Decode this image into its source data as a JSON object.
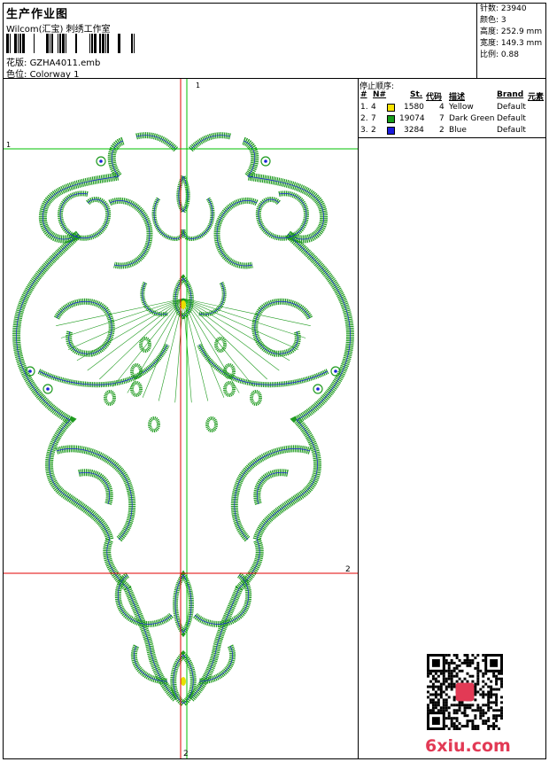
{
  "header": {
    "title": "生产作业图",
    "company": "Wilcom(汇宝) 刺绣工作室",
    "design_label": "花版:",
    "design_value": "GZHA4011.emb",
    "colorway_label": "色位:",
    "colorway_value": "Colorway 1"
  },
  "stats": [
    {
      "label": "针数:",
      "value": "23940"
    },
    {
      "label": "颜色:",
      "value": "3"
    },
    {
      "label": "高度:",
      "value": "252.9 mm"
    },
    {
      "label": "宽度:",
      "value": "149.3 mm"
    },
    {
      "label": "比例:",
      "value": "0.88"
    }
  ],
  "legend": {
    "title": "停止顺序:",
    "headers": [
      "#",
      "N#",
      "St.",
      "代码",
      "描述",
      "Brand",
      "元素"
    ],
    "rows": [
      {
        "idx": "1.",
        "n": "4",
        "color": "#f7e300",
        "st": "1580",
        "code": "4",
        "desc": "Yellow",
        "brand": "Default"
      },
      {
        "idx": "2.",
        "n": "7",
        "color": "#179c1b",
        "st": "19074",
        "code": "7",
        "desc": "Dark Green",
        "brand": "Default"
      },
      {
        "idx": "3.",
        "n": "2",
        "color": "#1a1adb",
        "st": "3284",
        "code": "2",
        "desc": "Blue",
        "brand": "Default"
      }
    ]
  },
  "guides": {
    "v1": "1",
    "v2": "2",
    "h1": "1",
    "h2": "2"
  },
  "colors": {
    "thread_green": "#1f9b1f",
    "thread_blue": "#1a22d8",
    "thread_yellow": "#e8e000",
    "guide_red": "#e00000",
    "guide_green": "#00c000"
  },
  "watermark": "6xiu.com",
  "icons": [
    "barcode-icon",
    "qr-code-icon"
  ]
}
